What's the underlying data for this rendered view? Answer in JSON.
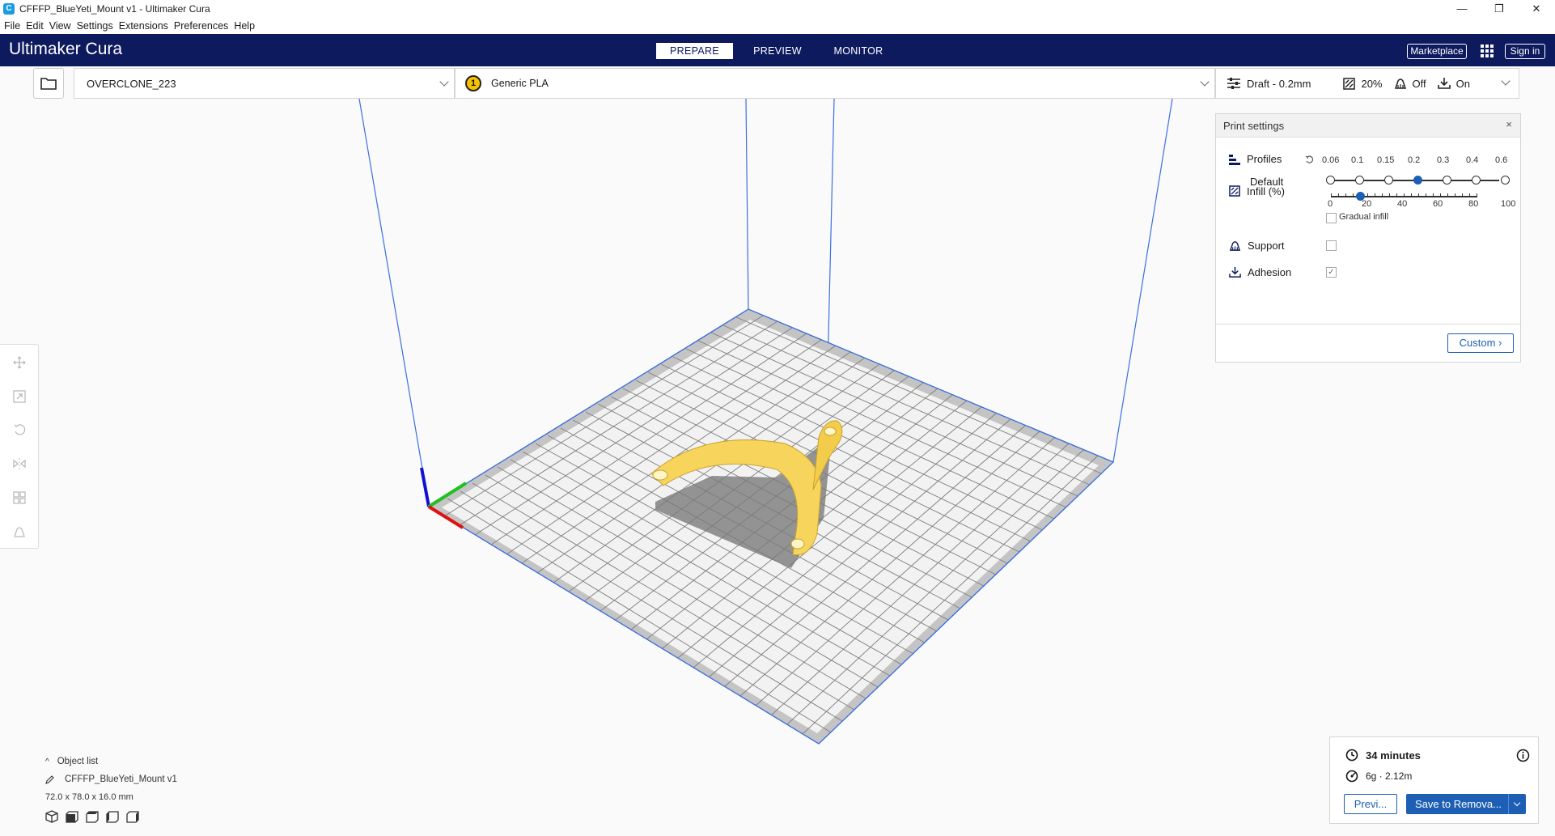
{
  "window": {
    "title": "CFFFP_BlueYeti_Mount v1 - Ultimaker Cura",
    "app_icon": "C"
  },
  "menu": [
    "File",
    "Edit",
    "View",
    "Settings",
    "Extensions",
    "Preferences",
    "Help"
  ],
  "header": {
    "logo_bold": "Ultimaker",
    "logo_light": " Cura",
    "tabs": [
      "PREPARE",
      "PREVIEW",
      "MONITOR"
    ],
    "active_tab": "PREPARE",
    "marketplace": "Marketplace",
    "signin": "Sign in"
  },
  "jobbar": {
    "machine": "OVERCLONE_223",
    "extruder_number": "1",
    "material": "Generic PLA",
    "profile": "Draft - 0.2mm",
    "infill": "20%",
    "support": "Off",
    "adhesion": "On"
  },
  "print_settings": {
    "title": "Print settings",
    "close": "×",
    "profiles_label": "Profiles",
    "profile_default": "Default",
    "layer_heights": [
      "0.06",
      "0.1",
      "0.15",
      "0.2",
      "0.3",
      "0.4",
      "0.6"
    ],
    "selected_layer_height": "0.2",
    "infill_label": "Infill (%)",
    "infill_ticks": [
      "0",
      "20",
      "40",
      "60",
      "80",
      "100"
    ],
    "infill_value": 20,
    "gradual_infill": "Gradual infill",
    "support_label": "Support",
    "support_checked": false,
    "adhesion_label": "Adhesion",
    "adhesion_checked": true,
    "custom_button": "Custom"
  },
  "object_list": {
    "header": "Object list",
    "object_name": "CFFFP_BlueYeti_Mount v1",
    "dimensions": "72.0 x 78.0 x 16.0 mm"
  },
  "summary": {
    "time": "34 minutes",
    "material": "6g · 2.12m",
    "preview_button": "Previ...",
    "save_button": "Save to Remova..."
  },
  "colors": {
    "header_bg": "#0e1a5e",
    "accent": "#1d5fb4",
    "model": "#f7d55c",
    "extruder": "#f6c200"
  }
}
